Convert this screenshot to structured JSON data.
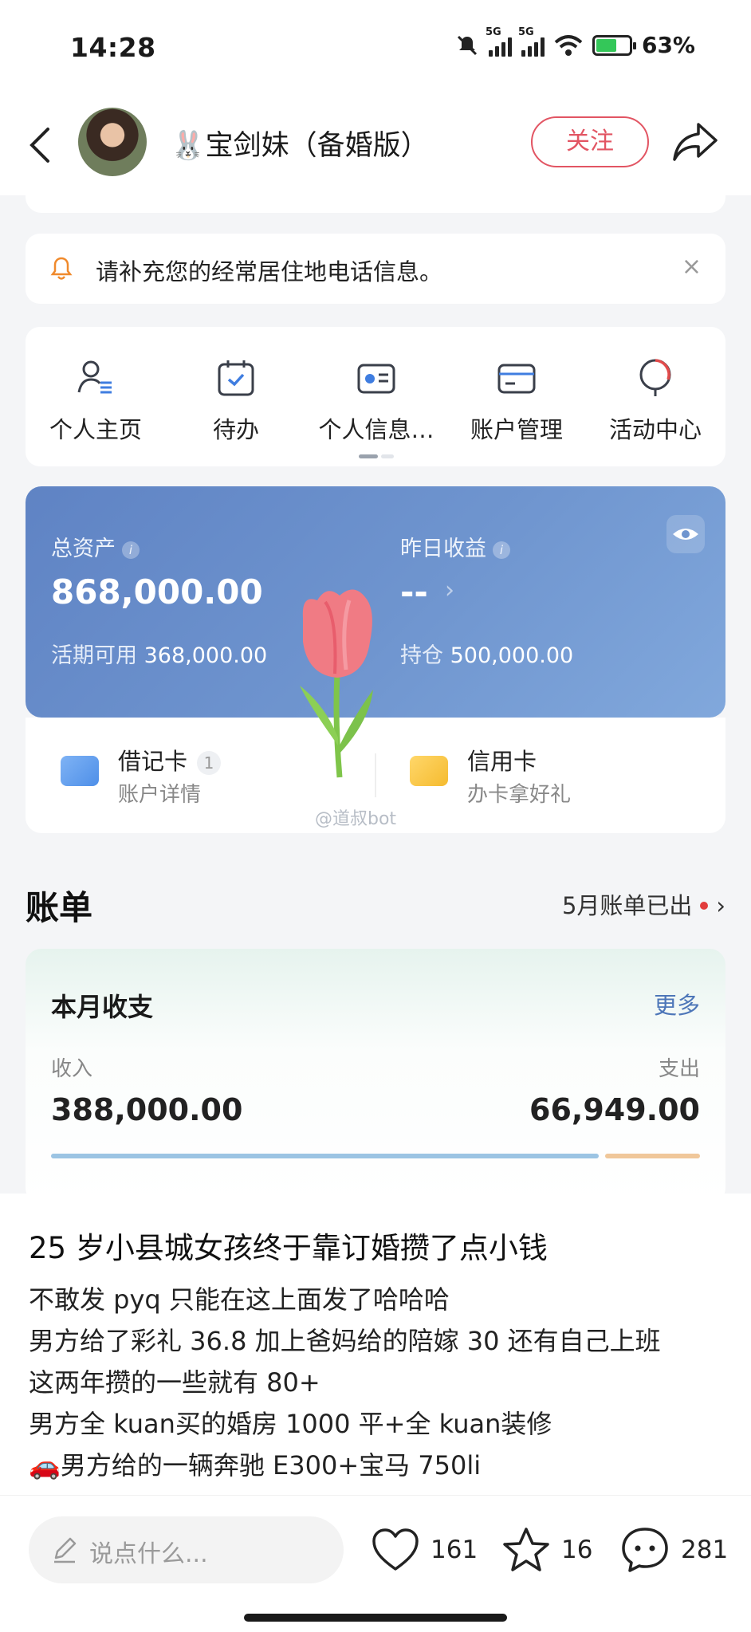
{
  "status_bar": {
    "time": "14:28",
    "battery": "63%",
    "network_1": "5G",
    "network_2": "5G"
  },
  "header": {
    "nickname": "🐰宝剑妹（备婚版）",
    "follow_label": "关注"
  },
  "notice": {
    "text": "请补充您的经常居住地电话信息。",
    "close": "×"
  },
  "quick_menu": [
    {
      "label": "个人主页",
      "icon": "person-list-icon"
    },
    {
      "label": "待办",
      "icon": "calendar-check-icon"
    },
    {
      "label": "个人信息…",
      "icon": "id-card-icon"
    },
    {
      "label": "账户管理",
      "icon": "bank-card-icon"
    },
    {
      "label": "活动中心",
      "icon": "balloon-icon"
    }
  ],
  "asset_card": {
    "total_label": "总资产",
    "total_value": "868,000.00",
    "available_label": "活期可用",
    "available_value": "368,000.00",
    "yesterday_label": "昨日收益",
    "yesterday_value": "--",
    "holding_label": "持仓",
    "holding_value": "500,000.00"
  },
  "cards": {
    "debit_title": "借记卡",
    "debit_count": "1",
    "debit_sub": "账户详情",
    "credit_title": "信用卡",
    "credit_sub": "办卡拿好礼"
  },
  "watermark": "@道叔bot",
  "bill": {
    "title": "账单",
    "status": "5月账单已出"
  },
  "monthly": {
    "title": "本月收支",
    "more": "更多",
    "income_label": "收入",
    "income_value": "388,000.00",
    "expense_label": "支出",
    "expense_value": "66,949.00"
  },
  "post": {
    "title": "25 岁小县城女孩终于靠订婚攒了点小钱",
    "lines": [
      "不敢发 pyq 只能在这上面发了哈哈哈",
      "男方给了彩礼 36.8 加上爸妈给的陪嫁 30 还有自己上班",
      "这两年攒的一些就有 80+",
      "男方全 kuan买的婚房 1000 平+全 kuan装修",
      "🚗男方给的一辆奔驰 E300+宝马 750li"
    ]
  },
  "bottom_bar": {
    "comment_placeholder": "说点什么...",
    "likes": "161",
    "favorites": "16",
    "comments": "281"
  },
  "colors": {
    "accent_red": "#e25563",
    "asset_blue": "#6f95cf",
    "link_blue": "#4d76b8",
    "income_bar": "#9cc4e3",
    "expense_bar": "#f0c79a"
  }
}
